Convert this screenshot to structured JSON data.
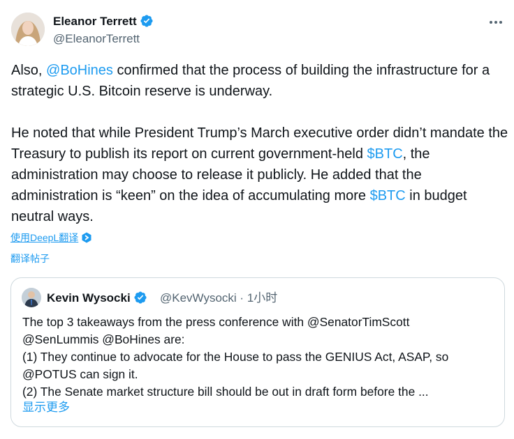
{
  "author": {
    "name": "Eleanor Terrett",
    "handle": "@EleanorTerrett",
    "avatar_icon": "avatar-photo",
    "verified_icon": "verified-badge-icon"
  },
  "tweet": {
    "p1_a": "Also, ",
    "p1_mention": "@BoHines",
    "p1_b": " confirmed that the process of building the infrastructure for a strategic U.S. Bitcoin reserve is underway.",
    "p2_a": "He noted that while President Trump’s March executive order didn’t mandate the Treasury to publish its report on current government-held ",
    "p2_cashtag1": "$BTC",
    "p2_b": ", the administration may choose to release it publicly. He added that the administration is “keen” on the idea of accumulating more ",
    "p2_cashtag2": "$BTC",
    "p2_c": " in budget neutral ways."
  },
  "translation": {
    "deepl_label": "使用DeepL翻译",
    "translate_post": "翻译帖子"
  },
  "quote": {
    "name": "Kevin Wysocki",
    "handle": "@KevWysocki",
    "separator": "·",
    "time": "1小时",
    "lines": [
      "The top 3 takeaways from the press conference with @SenatorTimScott",
      "@SenLummis @BoHines are:",
      "(1) They continue to advocate for the House to pass the GENIUS Act, ASAP, so",
      "@POTUS can sign it.",
      "(2) The Senate market structure bill should be out in draft form before the ..."
    ],
    "show_more": "显示更多"
  },
  "colors": {
    "link": "#1d9bf0",
    "text": "#0f1419",
    "secondary": "#536471",
    "border": "#cfd9de"
  }
}
